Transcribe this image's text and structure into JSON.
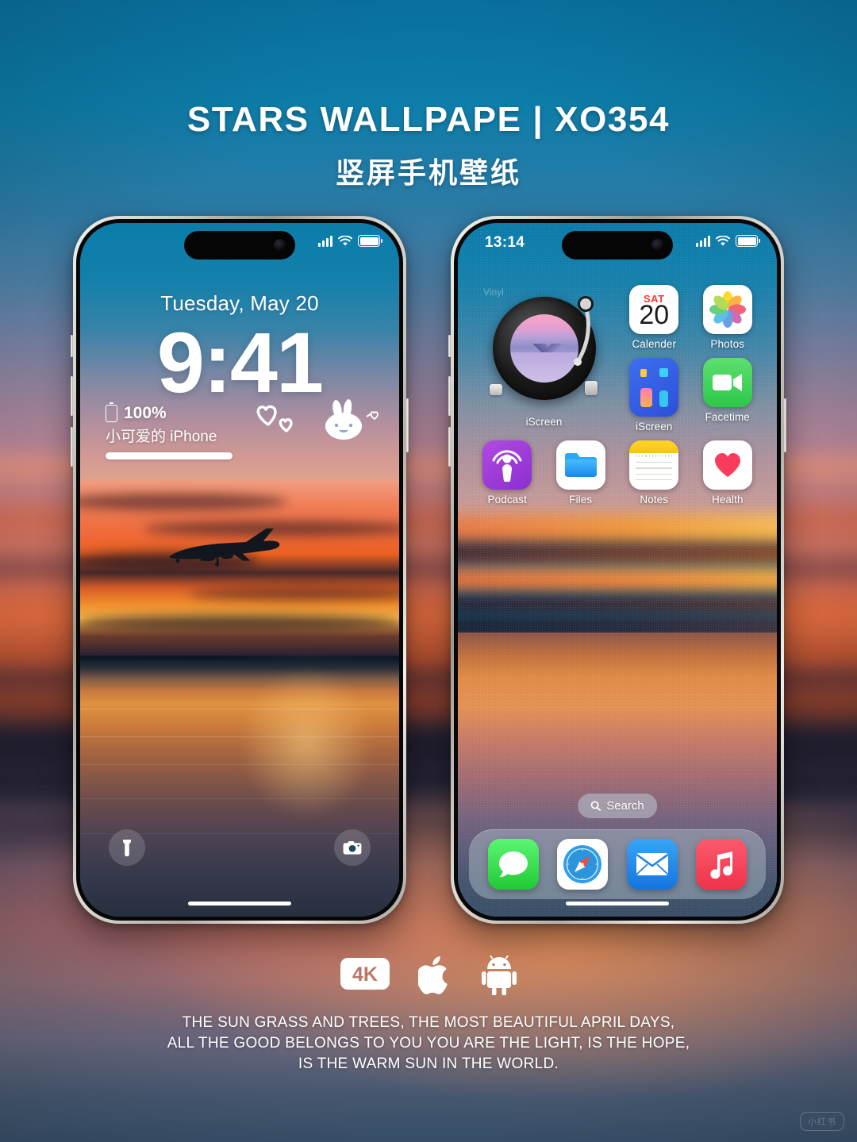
{
  "poster": {
    "title": "STARS WALLPAPE | XO354",
    "subtitle": "竖屏手机壁纸",
    "caption_line1": "THE SUN GRASS AND TREES, THE MOST BEAUTIFUL APRIL DAYS,",
    "caption_line2": "ALL THE GOOD BELONGS TO YOU YOU ARE THE LIGHT, IS THE HOPE,",
    "caption_line3": "IS THE WARM SUN IN THE WORLD.",
    "watermark": "小红书",
    "colors": {
      "backdrop_top": "#0d7eaa",
      "backdrop_mid": "#c96b55",
      "backdrop_bottom": "#3b5570",
      "title_text": "#ffffff"
    }
  },
  "badges": [
    {
      "name": "4k-badge",
      "label": "4K"
    },
    {
      "name": "apple-logo",
      "label": "Apple"
    },
    {
      "name": "android-logo",
      "label": "Android"
    }
  ],
  "lock_screen": {
    "status_bar": {
      "time": "",
      "signal": "signal-bars-icon",
      "wifi": "wifi-icon",
      "battery": "battery-full-icon"
    },
    "date": "Tuesday, May 20",
    "time": "9:41",
    "battery_percent": "100%",
    "device_name": "小可爱的 iPhone",
    "stickers": [
      "heart-outline-large",
      "heart-outline-small",
      "bunny-face"
    ],
    "controls": [
      {
        "name": "flashlight-button",
        "label": "Flashlight"
      },
      {
        "name": "camera-button",
        "label": "Camera"
      }
    ],
    "wallpaper_desc": "airplane-over-sunset-lake"
  },
  "home_screen": {
    "status_bar": {
      "time": "13:14",
      "signal": "signal-bars-icon",
      "wifi": "wifi-icon",
      "battery": "battery-full-icon"
    },
    "widget": {
      "name": "iScreen",
      "corner_label": "Vinyl",
      "type": "vinyl-turntable"
    },
    "apps": [
      {
        "label": "Calender",
        "icon": "calendar-icon",
        "day_abbr": "SAT",
        "day_num": "20"
      },
      {
        "label": "Photos",
        "icon": "photos-icon"
      },
      {
        "label": "iScreen",
        "icon": "iscreen-icon"
      },
      {
        "label": "Facetime",
        "icon": "facetime-icon"
      },
      {
        "label": "Podcast",
        "icon": "podcast-icon"
      },
      {
        "label": "Files",
        "icon": "files-icon"
      },
      {
        "label": "Notes",
        "icon": "notes-icon"
      },
      {
        "label": "Health",
        "icon": "health-icon"
      }
    ],
    "search": {
      "label": "Search",
      "icon": "search-icon"
    },
    "dock": [
      {
        "label": "Messages",
        "icon": "messages-icon"
      },
      {
        "label": "Safari",
        "icon": "safari-icon"
      },
      {
        "label": "Mail",
        "icon": "mail-icon"
      },
      {
        "label": "Music",
        "icon": "music-icon"
      }
    ]
  }
}
